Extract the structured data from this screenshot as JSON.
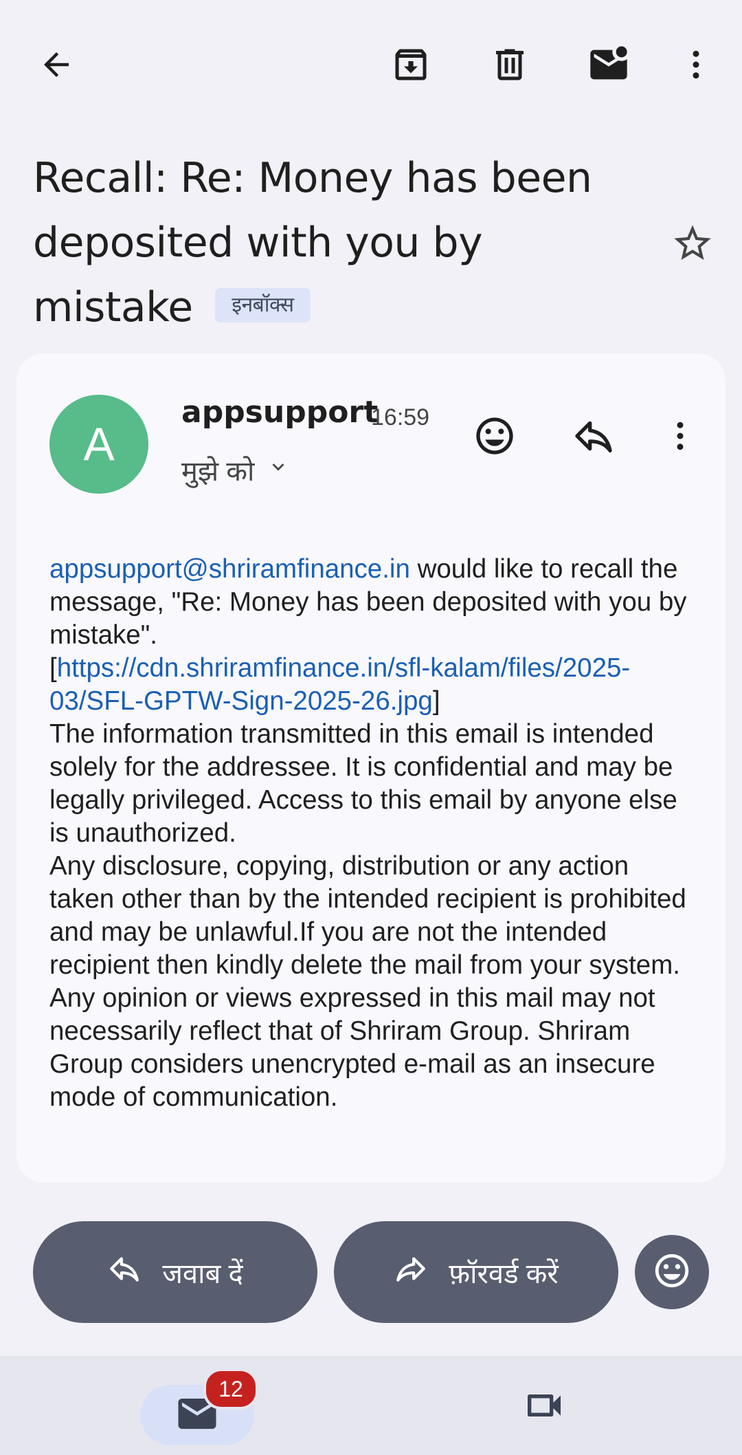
{
  "toolbar": {
    "back": "back-arrow-icon",
    "archive": "archive-icon",
    "delete": "delete-icon",
    "mark_unread": "mark-unread-icon",
    "more": "more-vert-icon"
  },
  "email": {
    "subject": "Recall: Re: Money has been deposited with you by mistake",
    "label": "इनबॉक्स",
    "starred": false,
    "sender_initial": "A",
    "sender_name": "appsupport",
    "time": "16:59",
    "to": "मुझे को",
    "body": {
      "sender_link": "appsupport@shriramfinance.in",
      "recall_text": " would like to recall the message, \"Re: Money has been deposited with you by mistake\".",
      "bracket_open": "[",
      "image_link": "https://cdn.shriramfinance.in/sfl-kalam/files/2025-03/SFL-GPTW-Sign-2025-26.jpg",
      "bracket_close": "]",
      "para1": "The information transmitted in this email is intended solely for the addressee. It is confidential and may be legally privileged. Access to this email by anyone else is unauthorized.",
      "para2": "Any disclosure, copying, distribution or any action taken other than by the intended recipient is prohibited and may be unlawful.If you are not the intended recipient then kindly delete the mail from your system.",
      "para3": "Any opinion or views expressed in this mail may not necessarily reflect that of Shriram Group. Shriram Group considers unencrypted e-mail as an insecure mode of communication."
    }
  },
  "actions": {
    "reply": "जवाब दें",
    "forward": "फ़ॉरवर्ड करें"
  },
  "bottom_nav": {
    "mail_badge": "12"
  },
  "colors": {
    "avatar": "#57bb8a",
    "pill": "#585e6f",
    "link": "#1a5fb4",
    "badge": "#c5221f"
  }
}
